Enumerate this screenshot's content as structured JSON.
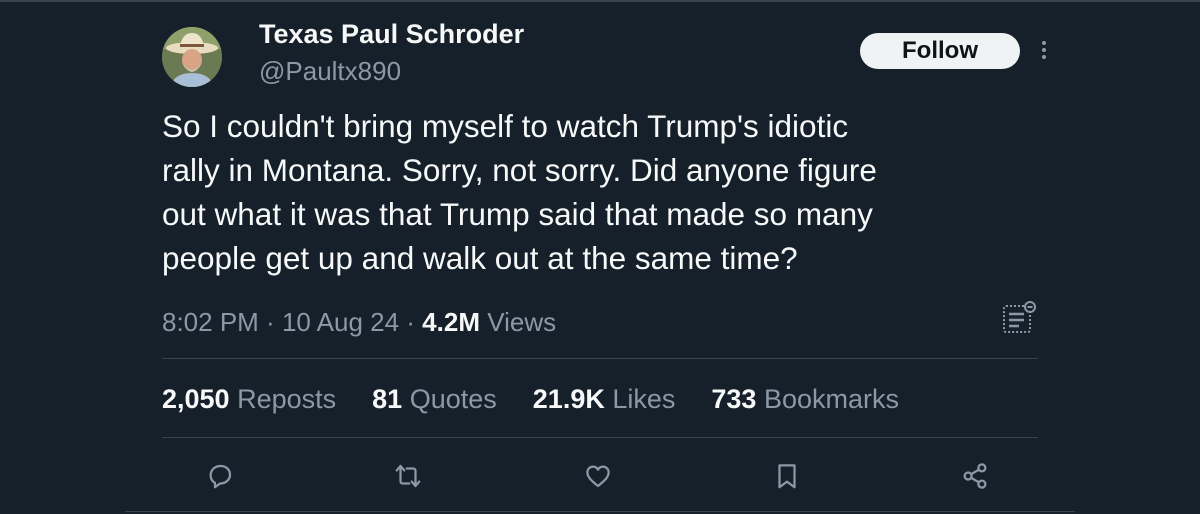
{
  "tweet": {
    "author_name": "Texas Paul Schroder",
    "author_handle": "@Paultx890",
    "follow_label": "Follow",
    "text": "So I couldn't bring myself to watch Trump's idiotic\nrally in Montana. Sorry, not sorry.  Did anyone figure\nout what it was that Trump said that made so many\npeople get up and walk out at the same time?",
    "time": "8:02 PM",
    "date": "10 Aug 24",
    "views_count": "4.2M",
    "views_label": "Views"
  },
  "stats": {
    "reposts_count": "2,050",
    "reposts_label": "Reposts",
    "quotes_count": "81",
    "quotes_label": "Quotes",
    "likes_count": "21.9K",
    "likes_label": "Likes",
    "bookmarks_count": "733",
    "bookmarks_label": "Bookmarks"
  },
  "icons": {
    "more": "more-options-icon",
    "analytics": "analytics-icon",
    "reply": "reply-icon",
    "repost": "repost-icon",
    "like": "like-icon",
    "bookmark": "bookmark-icon",
    "share": "share-icon"
  },
  "colors": {
    "background": "#15202b",
    "text_primary": "#f7f9f9",
    "text_secondary": "#8b98a5",
    "divider": "#38444d",
    "follow_button_bg": "#eff3f4"
  }
}
